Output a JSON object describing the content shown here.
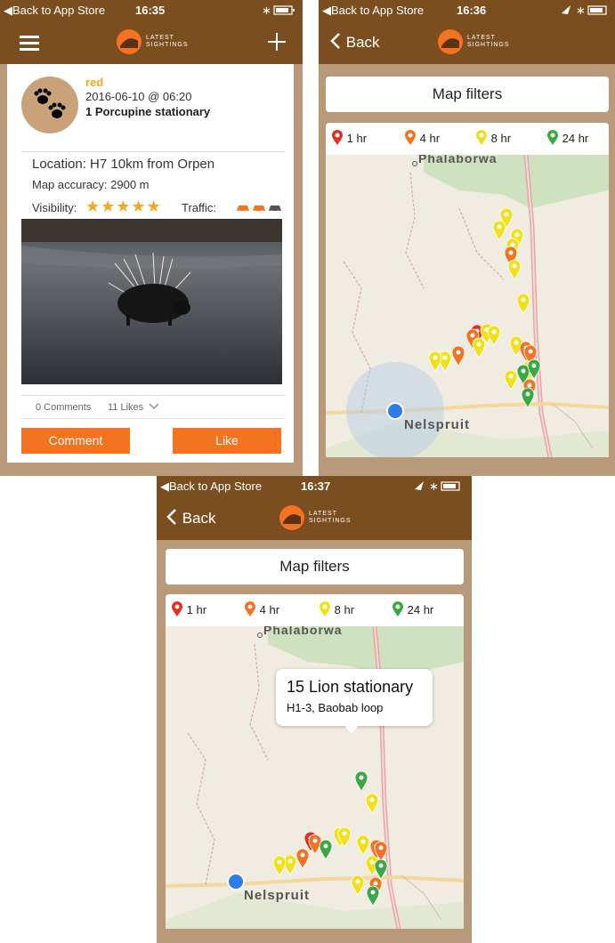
{
  "status": {
    "back_to_store": "Back to App Store",
    "screen1_time": "16:35",
    "screen2_time": "16:36",
    "screen3_time": "16:37"
  },
  "nav": {
    "back_label": "Back",
    "logo_line1": "LATEST",
    "logo_line2": "SIGHTINGS"
  },
  "sighting": {
    "reporter": "red",
    "datetime": "2016-06-10 @ 06:20",
    "title": "1 Porcupine stationary",
    "location": "Location: H7 10km from Orpen",
    "accuracy": "Map accuracy: 2900 m",
    "visibility_label": "Visibility:",
    "stars": "★★★★★",
    "traffic_label": "Traffic:",
    "comments": "0 Comments",
    "likes": "11 Likes",
    "comment_button": "Comment",
    "like_button": "Like"
  },
  "map": {
    "filters_button": "Map filters",
    "legend": [
      {
        "label": "1 hr",
        "color": "#e62e1f"
      },
      {
        "label": "4 hr",
        "color": "#f37321"
      },
      {
        "label": "8 hr",
        "color": "#f2e01c"
      },
      {
        "label": "24 hr",
        "color": "#3aa843"
      }
    ],
    "town_north": "Phalaborwa",
    "town_south": "Nelspruit",
    "popup_title": "15 Lion stationary",
    "popup_subtitle": "H1-3, Baobab loop"
  },
  "colors": {
    "brown": "#7b4e1f",
    "tan": "#b89a7b",
    "orange": "#f37321",
    "star": "#f5a623"
  }
}
